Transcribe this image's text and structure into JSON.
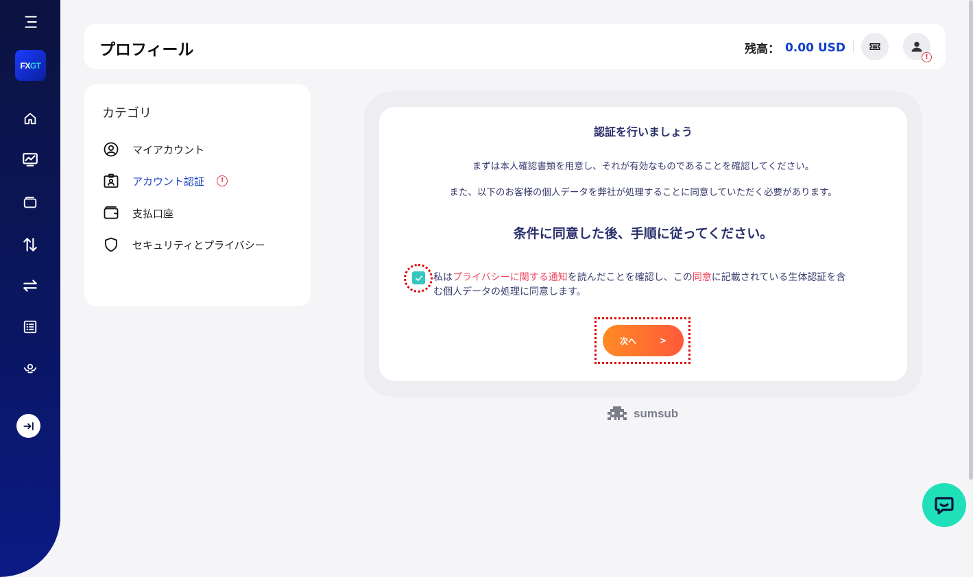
{
  "sidebar": {
    "logo_text_fx": "FX",
    "logo_text_gt": "GT",
    "items": [
      "menu-icon",
      "home-icon",
      "chart-icon",
      "wallet-icon",
      "transfer-vertical-icon",
      "exchange-icon",
      "list-icon",
      "ib-icon"
    ],
    "collapse_icon": "arrow-right-bar-icon"
  },
  "header": {
    "title": "プロフィール",
    "balance_label": "残高：",
    "balance_value": "0.00 USD"
  },
  "category": {
    "title": "カテゴリ",
    "items": [
      {
        "label": "マイアカウント",
        "icon": "user-circle-icon"
      },
      {
        "label": "アカウント認証",
        "icon": "id-card-icon"
      },
      {
        "label": "支払口座",
        "icon": "wallet-icon"
      },
      {
        "label": "セキュリティとプライバシー",
        "icon": "shield-icon"
      }
    ],
    "alert_glyph": "!"
  },
  "verify": {
    "title": "認証を行いましょう",
    "text1": "まずは本人確認書類を用意し、それが有効なものであることを確認してください。",
    "text2": "また、以下のお客様の個人データを弊社が処理することに同意していただく必要があります。",
    "subtitle": "条件に同意した後、手順に従ってください。",
    "consent_part1": "私は",
    "consent_link1": "プライバシーに関する通知",
    "consent_part2": "を読んだことを確認し、この",
    "consent_link2": "同意",
    "consent_part3": "に記載されている生体認証を含む個人データの処理に同意します。",
    "next_label": "次へ",
    "next_arrow": ">",
    "checkbox_checked": true
  },
  "brand": {
    "sumsub": "sumsub"
  },
  "colors": {
    "accent_blue": "#1140c9",
    "orange_start": "#ff8a24",
    "orange_end": "#ff5a3a",
    "teal": "#36c6bd",
    "chat": "#1fe0b9",
    "alert": "#e0393e"
  }
}
